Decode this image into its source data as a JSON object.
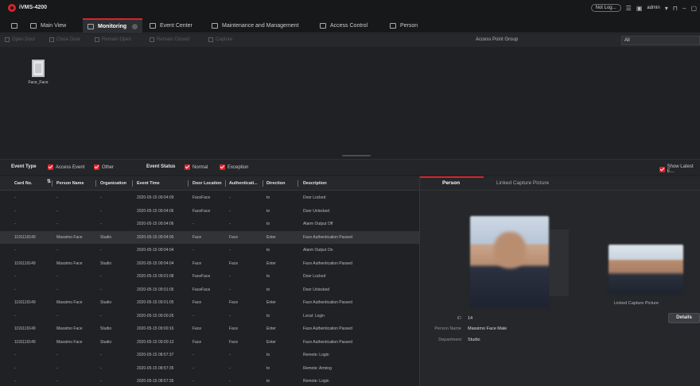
{
  "app": {
    "title": "iVMS-4200",
    "not_logged": "Not Log...",
    "user": "admin"
  },
  "nav": [
    {
      "label": "Main View"
    },
    {
      "label": "Monitoring"
    },
    {
      "label": "Event Center"
    },
    {
      "label": "Maintenance and Management"
    },
    {
      "label": "Access Control"
    },
    {
      "label": "Person"
    }
  ],
  "toolbar": {
    "open_door": "Open Door",
    "close_door": "Close Door",
    "remain_open": "Remain Open",
    "remain_closed": "Remain Closed",
    "capture": "Capture",
    "apg_label": "Access Point Group",
    "apg_value": "All"
  },
  "door": {
    "label": "Face_Face"
  },
  "filters": {
    "event_type_label": "Event Type",
    "access_event": "Access Event",
    "other": "Other",
    "event_status_label": "Event Status",
    "normal": "Normal",
    "exception": "Exception",
    "show_latest": "Show Latest E..."
  },
  "table": {
    "columns": [
      "Card No.",
      "Person Name",
      "Organization",
      "Event Time",
      "Door Location",
      "Authenticati...",
      "Direction",
      "Description"
    ],
    "rows": [
      [
        "-",
        "-",
        "-",
        "2020-05-15 09:04:09",
        "FaceFace",
        "-",
        "to",
        "Door Locked"
      ],
      [
        "-",
        "-",
        "-",
        "2020-05-15 09:04:06",
        "FaceFace",
        "-",
        "to",
        "Door Unlocked"
      ],
      [
        "-",
        "-",
        "-",
        "2020-05-15 09:04:06",
        "-",
        "-",
        "to",
        "Alarm Output Off"
      ],
      [
        "1191119149",
        "Massimo Face",
        "Studio",
        "2020-05-15 09:04:06",
        "Face",
        "Face",
        "Enter",
        "Face Authentication Passed"
      ],
      [
        "-",
        "-",
        "-",
        "2020-05-15 09:04:04",
        "-",
        "-",
        "to",
        "Alarm Output On"
      ],
      [
        "1191119149",
        "Massimo Face",
        "Studio",
        "2020-05-15 09:04:04",
        "Face",
        "Face",
        "Enter",
        "Face Authentication Passed"
      ],
      [
        "-",
        "-",
        "-",
        "2020-05-15 09:01:08",
        "FaceFace",
        "-",
        "to",
        "Door Locked"
      ],
      [
        "-",
        "-",
        "-",
        "2020-05-15 09:01:05",
        "FaceFace",
        "-",
        "to",
        "Door Unlocked"
      ],
      [
        "1191119149",
        "Massimo Face",
        "Studio",
        "2020-05-15 09:01:05",
        "Face",
        "Face",
        "Enter",
        "Face Authentication Passed"
      ],
      [
        "-",
        "-",
        "-",
        "2020-05-15 09:00:26",
        "-",
        "-",
        "to",
        "Local: Login"
      ],
      [
        "1191119149",
        "Massimo Face",
        "Studio",
        "2020-05-15 09:00:16",
        "Face",
        "Face",
        "Enter",
        "Face Authentication Passed"
      ],
      [
        "1191119149",
        "Massimo Face",
        "Studio",
        "2020-05-15 09:00:13",
        "Face",
        "Face",
        "Enter",
        "Face Authentication Passed"
      ],
      [
        "-",
        "-",
        "-",
        "2020-05-15 08:57:37",
        "-",
        "-",
        "to",
        "Remote: Login"
      ],
      [
        "-",
        "-",
        "-",
        "2020-05-15 08:57:35",
        "-",
        "-",
        "to",
        "Remote: Arming"
      ],
      [
        "-",
        "-",
        "-",
        "2020-05-15 08:57:35",
        "-",
        "-",
        "to",
        "Remote: Login"
      ]
    ]
  },
  "panel": {
    "tab_person": "Person",
    "tab_capture": "Linked Capture Picture",
    "capture_label": "Linked Capture Picture",
    "details": "Details",
    "id_label": "ID",
    "id_value": "14",
    "name_label": "Person Name",
    "name_value": "Massimo Face  Male",
    "dept_label": "Department",
    "dept_value": "Studio"
  },
  "colors": {
    "accent": "#d9232d",
    "background": "#1f2124",
    "header": "#17181a"
  }
}
